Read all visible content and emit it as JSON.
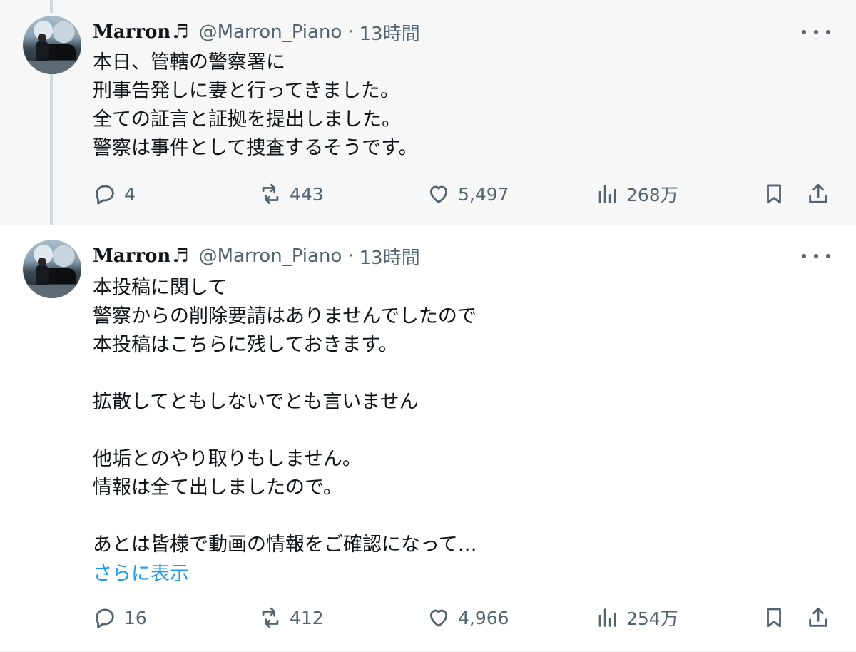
{
  "tweets": [
    {
      "author": {
        "name": "Marron",
        "note": "♬",
        "handle": "@Marron_Piano"
      },
      "separator": "·",
      "time": "13時間",
      "text": "本日、管轄の警察署に\n刑事告発しに妻と行ってきました。\n全ての証言と証拠を提出しました。\n警察は事件として捜査するそうです。",
      "stats": {
        "replies": "4",
        "retweets": "443",
        "likes": "5,497",
        "views": "268万"
      }
    },
    {
      "author": {
        "name": "Marron",
        "note": "♬",
        "handle": "@Marron_Piano"
      },
      "separator": "·",
      "time": "13時間",
      "text": "本投稿に関して\n警察からの削除要請はありませんでしたので\n本投稿はこちらに残しておきます。\n\n拡散してともしないでとも言いません\n\n他垢とのやり取りもしません。\n情報は全て出しましたので。\n\nあとは皆様で動画の情報をご確認になって…",
      "show_more": "さらに表示",
      "stats": {
        "replies": "16",
        "retweets": "412",
        "likes": "4,966",
        "views": "254万"
      }
    }
  ],
  "colors": {
    "link": "#1d9bf0",
    "muted": "#536471",
    "text": "#0f1419",
    "first_bg": "#f7f7f7"
  },
  "icons": [
    "more-icon",
    "reply-icon",
    "retweet-icon",
    "like-icon",
    "views-icon",
    "bookmark-icon",
    "share-icon"
  ]
}
